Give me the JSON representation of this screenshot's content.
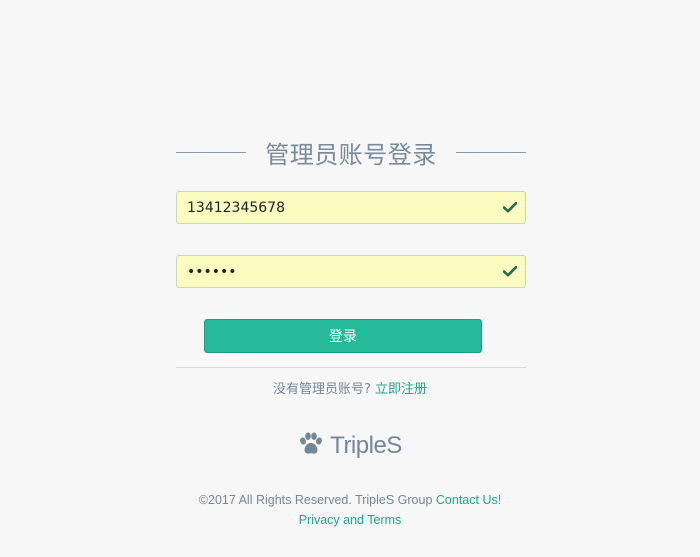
{
  "header": {
    "title": "管理员账号登录"
  },
  "form": {
    "phone_value": "13412345678",
    "password_value": "123456",
    "login_label": "登录",
    "check_icon": "check-icon"
  },
  "register": {
    "prompt": "没有管理员账号?",
    "link_label": "立即注册"
  },
  "brand": {
    "icon": "paw-icon",
    "name": "TripleS"
  },
  "footer": {
    "copyright": "©2017 All Rights Reserved. TripleS Group",
    "contact_label": "Contact Us!",
    "privacy_label": "Privacy and Terms"
  },
  "colors": {
    "background": "#f7f7f7",
    "accent": "#26b99a",
    "link": "#1aa88a",
    "text": "#73879c",
    "autofill": "#fbfdc0",
    "check": "#2a6b4a"
  }
}
